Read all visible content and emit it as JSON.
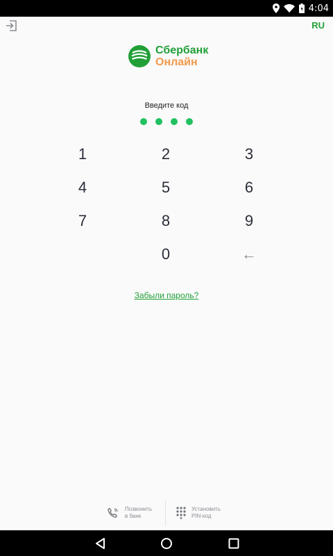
{
  "status_bar": {
    "time": "4:04"
  },
  "header": {
    "language": "RU"
  },
  "logo": {
    "line1": "Сбербанк",
    "line2": "Онлайн"
  },
  "pin": {
    "prompt": "Введите код",
    "entered_count": 4,
    "length": 4
  },
  "keypad": {
    "rows": [
      [
        "1",
        "2",
        "3"
      ],
      [
        "4",
        "5",
        "6"
      ],
      [
        "7",
        "8",
        "9"
      ],
      [
        "",
        "0",
        "←"
      ]
    ]
  },
  "forgot_link": "Забыли пароль?",
  "actions": {
    "call_line1": "Позвонить",
    "call_line2": "в банк",
    "pin_line1": "Установить",
    "pin_line2": "PIN-код"
  },
  "colors": {
    "accent": "#21a038",
    "pin_dot": "#21c060",
    "logo_orange": "#f2994a"
  }
}
